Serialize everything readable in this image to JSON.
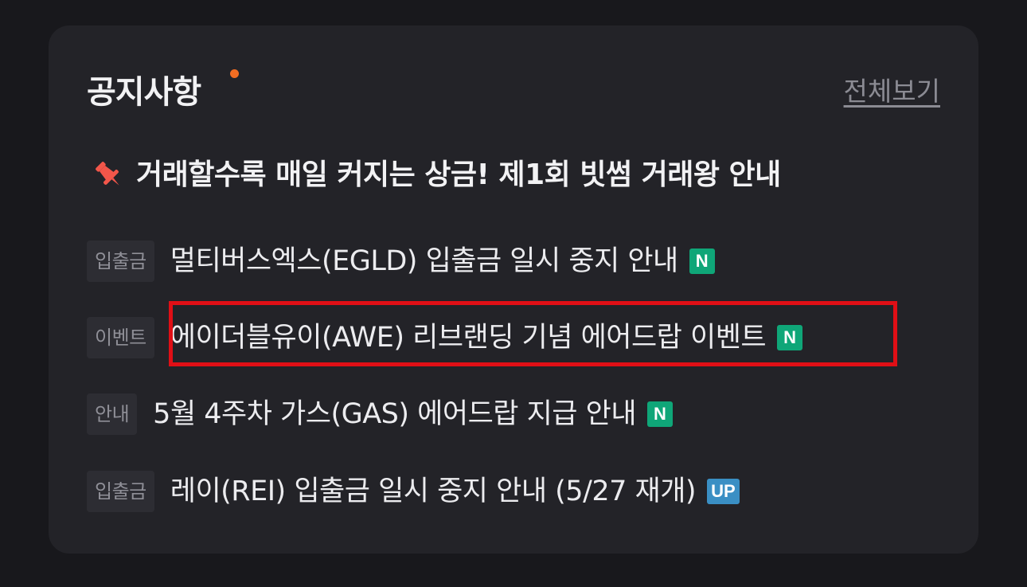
{
  "notice": {
    "title": "공지사항",
    "view_all": "전체보기",
    "pinned": {
      "icon": "pushpin-icon",
      "text": "거래할수록 매일 커지는 상금! 제1회 빗썸 거래왕 안내"
    },
    "items": [
      {
        "category": "입출금",
        "text": "멀티버스엑스(EGLD) 입출금 일시 중지 안내",
        "badge": "N"
      },
      {
        "category": "이벤트",
        "text": "에이더블유이(AWE) 리브랜딩 기념 에어드랍 이벤트",
        "badge": "N"
      },
      {
        "category": "안내",
        "text": "5월 4주차 가스(GAS) 에어드랍 지급 안내",
        "badge": "N"
      },
      {
        "category": "입출금",
        "text": "레이(REI) 입출금 일시 중지 안내 (5/27 재개)",
        "badge": "UP"
      }
    ]
  },
  "colors": {
    "background": "#18181c",
    "card": "#232328",
    "accent_dot": "#f26d22",
    "pin": "#f2564a",
    "badge_new": "#0fa678",
    "badge_up": "#3a8fc4",
    "highlight": "#e00f16"
  }
}
